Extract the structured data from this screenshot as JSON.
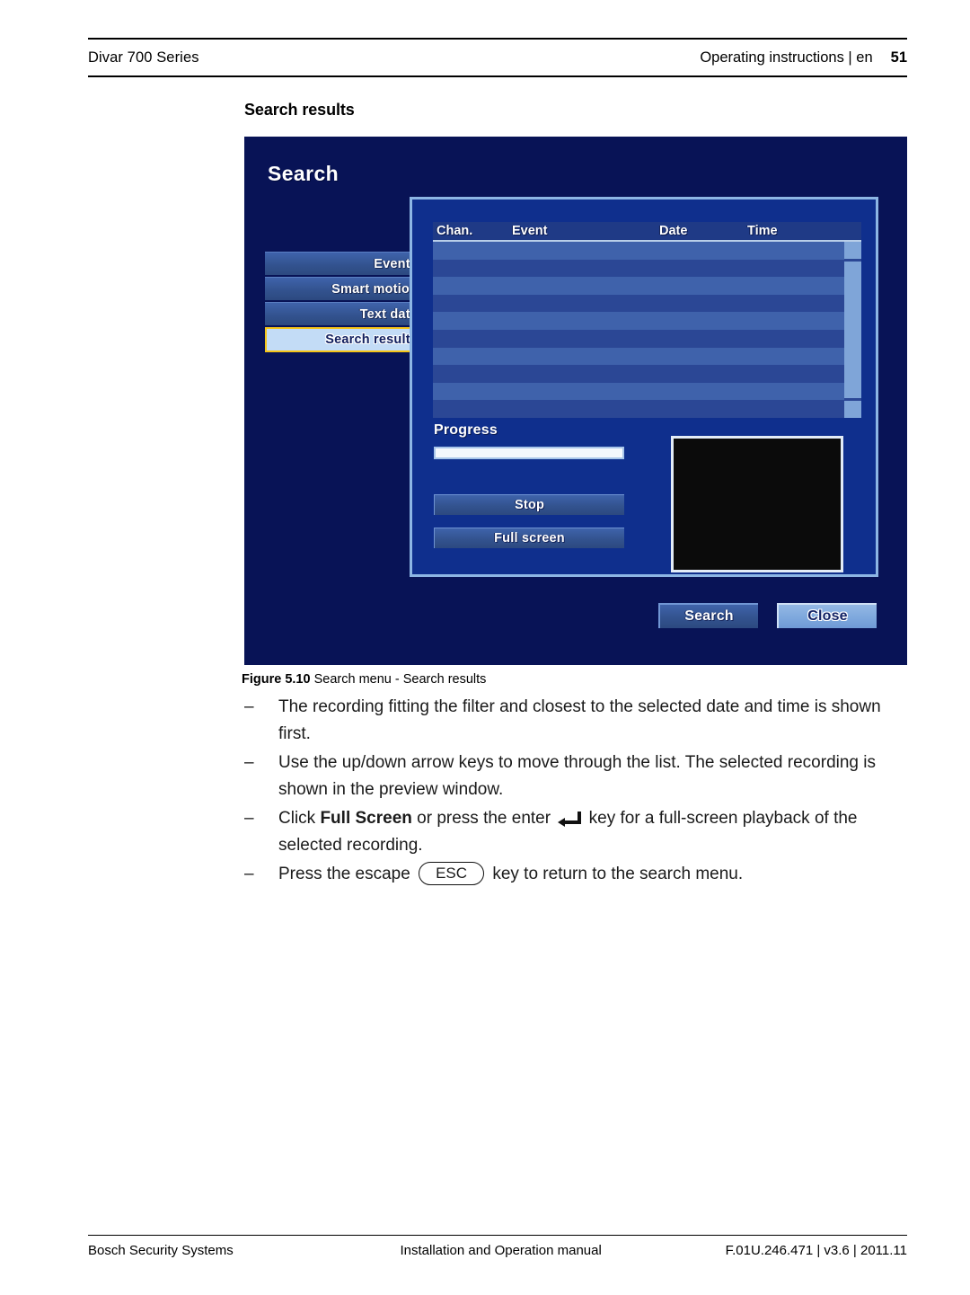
{
  "header": {
    "left": "Divar 700 Series",
    "doc": "Operating instructions | en",
    "page": "51"
  },
  "section": {
    "title": "Search results"
  },
  "screenshot": {
    "title": "Search",
    "menu": {
      "items": [
        {
          "label": "Events",
          "selected": false
        },
        {
          "label": "Smart motion",
          "selected": false
        },
        {
          "label": "Text data",
          "selected": false
        },
        {
          "label": "Search results",
          "selected": true
        }
      ]
    },
    "table": {
      "columns": [
        "Chan.",
        "Event",
        "Date",
        "Time"
      ],
      "rows": [],
      "empty_row_count": 10,
      "scrollbar": {
        "visible": true
      }
    },
    "progress": {
      "label": "Progress",
      "percent": 100
    },
    "panel_buttons": {
      "stop": "Stop",
      "fullscreen": "Full screen"
    },
    "preview": {
      "state": "blank"
    },
    "actions": {
      "search": "Search",
      "close": "Close",
      "selected": "Close"
    },
    "colors": {
      "background": "#081356",
      "panel": "#0f2f8d",
      "panel_border": "#8db6e4",
      "button": "#33538f",
      "selection_highlight": "#f5c518",
      "selected_item_bg": "#c3dcf6",
      "row_odd": "#3f62ab",
      "row_even": "#2b4795",
      "scrollbar": "#7fa5d8",
      "preview": "#0b0b0b"
    }
  },
  "figure": {
    "label": "Figure 5.10",
    "caption": "Search menu - Search results"
  },
  "bullets": [
    {
      "dash": "–",
      "parts": [
        {
          "type": "text",
          "text": "The recording fitting the filter and closest to the selected date and time is shown first."
        }
      ]
    },
    {
      "dash": "–",
      "parts": [
        {
          "type": "text",
          "text": "Use the up/down arrow keys to move through the list. The selected recording is shown in the preview window."
        }
      ]
    },
    {
      "dash": "–",
      "parts": [
        {
          "type": "text",
          "text": "Click "
        },
        {
          "type": "bold",
          "text": "Full Screen"
        },
        {
          "type": "text",
          "text": " or press the enter "
        },
        {
          "type": "key",
          "icon": "enter-key-icon"
        },
        {
          "type": "text",
          "text": " key for a full-screen playback of the selected recording."
        }
      ]
    },
    {
      "dash": "–",
      "parts": [
        {
          "type": "text",
          "text": "Press the escape "
        },
        {
          "type": "keycap",
          "text": "ESC"
        },
        {
          "type": "text",
          "text": " key to return to the search menu."
        }
      ]
    }
  ],
  "footer": {
    "left": "Bosch Security Systems",
    "middle": "Installation and Operation manual",
    "right": "F.01U.246.471 | v3.6 | 2011.11"
  }
}
